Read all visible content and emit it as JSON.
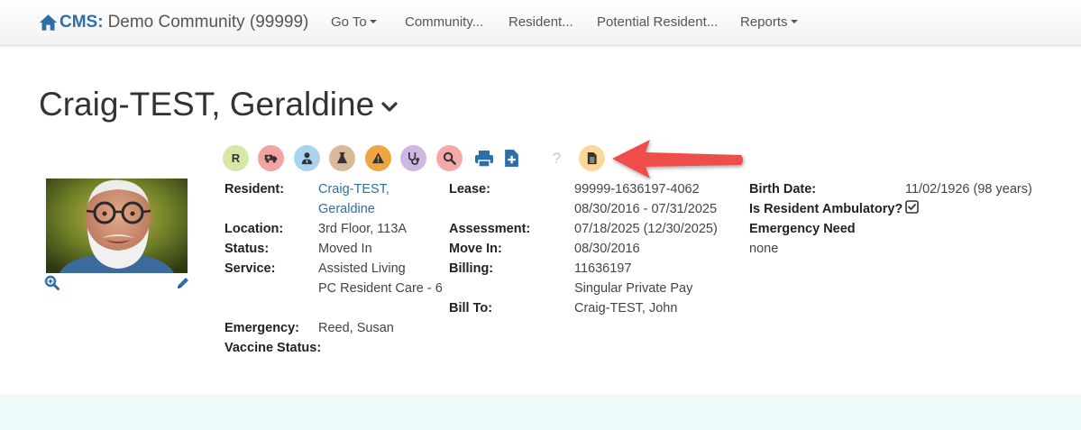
{
  "nav": {
    "brand_cms": "CMS:",
    "brand_community": "Demo Community (99999)",
    "goto_label": "Go To",
    "community_label": "Community...",
    "resident_label": "Resident...",
    "potential_label": "Potential Resident...",
    "reports_label": "Reports"
  },
  "resident_name": "Craig-TEST, Geraldine",
  "icon_bar": {
    "r_badge": "R",
    "question": "?",
    "colors": {
      "r": "#d6e7a6",
      "ambulance": "#f4a3a3",
      "doctor": "#a9d3ee",
      "lab": "#d8b99a",
      "warning": "#f0a640",
      "stethoscope": "#cfb7e3",
      "search": "#f5a8a8",
      "document": "#fbd79a"
    }
  },
  "info": {
    "resident_label": "Resident:",
    "resident_value_line1": "Craig-TEST,",
    "resident_value_line2": "Geraldine",
    "location_label": "Location:",
    "location_value": "3rd Floor, 113A",
    "status_label": "Status:",
    "status_value": "Moved In",
    "service_label": "Service:",
    "service_value_line1": "Assisted Living",
    "service_value_line2": "PC Resident Care - 6",
    "emergency_label": "Emergency:",
    "emergency_value": "Reed, Susan",
    "vaccine_label": "Vaccine Status:",
    "lease_label": "Lease:",
    "lease_value_line1": "99999-1636197-4062",
    "lease_value_line2": "08/30/2016 - 07/31/2025",
    "assessment_label": "Assessment:",
    "assessment_value": "07/18/2025 (12/30/2025)",
    "movein_label": "Move In:",
    "movein_value": "08/30/2016",
    "billing_label": "Billing:",
    "billing_value_line1": "11636197",
    "billing_value_line2": "Singular Private Pay",
    "billto_label": "Bill To:",
    "billto_value": "Craig-TEST, John",
    "birth_label": "Birth Date:",
    "birth_value": "11/02/1926 (98 years)",
    "ambulatory_label": "Is Resident Ambulatory?",
    "ambulatory_checked": true,
    "emergency_need_label": "Emergency Need",
    "emergency_need_value": "none"
  }
}
